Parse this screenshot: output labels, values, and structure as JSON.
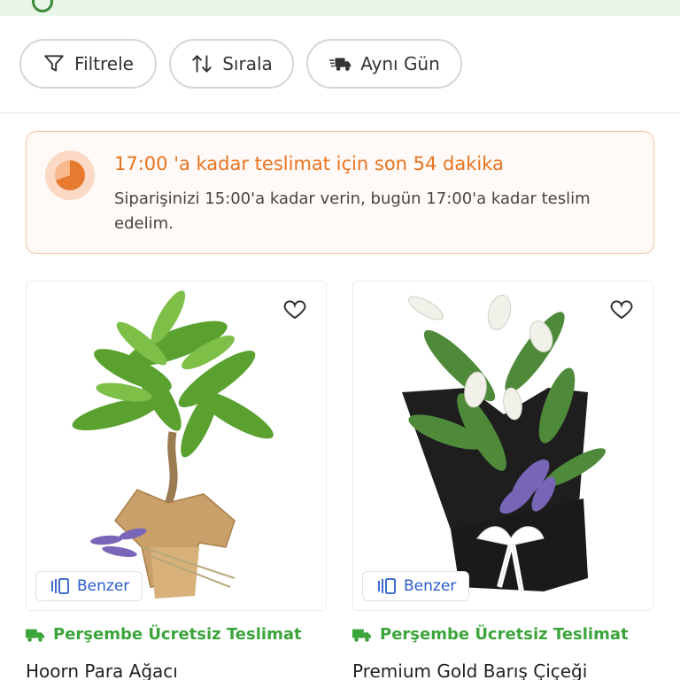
{
  "toolbar": {
    "filter_label": "Filtrele",
    "sort_label": "Sırala",
    "same_day_label": "Aynı Gün"
  },
  "banner": {
    "title": "17:00 'a kadar teslimat için son 54 dakika",
    "description": "Siparişinizi 15:00'a kadar verin, bugün 17:00'a kadar teslim edelim."
  },
  "products": [
    {
      "name": "Hoorn Para Ağacı",
      "delivery": "Perşembe Ücretsiz Teslimat",
      "similar_label": "Benzer"
    },
    {
      "name": "Premium Gold Barış Çiçeği",
      "delivery": "Perşembe Ücretsiz Teslimat",
      "similar_label": "Benzer"
    }
  ],
  "colors": {
    "accent_orange": "#e8731f",
    "delivery_green": "#3ba53b",
    "link_blue": "#2a5cc7",
    "top_strip": "#e8f5e8"
  },
  "icons": {
    "filter": "funnel-icon",
    "sort": "sort-arrows-icon",
    "same_day": "fast-truck-icon",
    "banner": "clock-icon",
    "favorite": "heart-icon",
    "similar": "similar-items-icon",
    "delivery": "truck-icon"
  }
}
